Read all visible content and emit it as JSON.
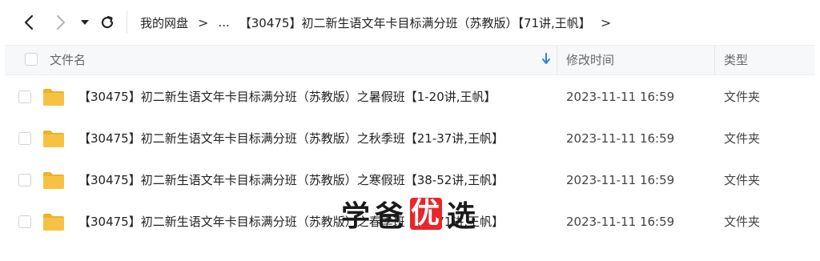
{
  "toolbar": {
    "back_icon": "chevron-left-icon",
    "forward_icon": "chevron-right-icon",
    "dropdown_icon": "caret-down-icon",
    "refresh_icon": "refresh-icon"
  },
  "breadcrumb": {
    "items": [
      "我的网盘",
      "...",
      "【30475】初二新生语文年卡目标满分班（苏教版）【71讲,王帆】"
    ],
    "separator": ">"
  },
  "table": {
    "columns": {
      "name": "文件名",
      "modified": "修改时间",
      "type": "类型"
    },
    "sort_icon": "sort-down-arrow-icon",
    "rows": [
      {
        "name": "【30475】初二新生语文年卡目标满分班（苏教版）之暑假班【1-20讲,王帆】",
        "modified": "2023-11-11 16:59",
        "type": "文件夹"
      },
      {
        "name": "【30475】初二新生语文年卡目标满分班（苏教版）之秋季班【21-37讲,王帆】",
        "modified": "2023-11-11 16:59",
        "type": "文件夹"
      },
      {
        "name": "【30475】初二新生语文年卡目标满分班（苏教版）之寒假班【38-52讲,王帆】",
        "modified": "2023-11-11 16:59",
        "type": "文件夹"
      },
      {
        "name": "【30475】初二新生语文年卡目标满分班（苏教版）之春季班【53-71讲,王帆】",
        "modified": "2023-11-11 16:59",
        "type": "文件夹"
      }
    ]
  },
  "watermark": {
    "chars": [
      "学",
      "爸",
      "优",
      "选"
    ]
  },
  "colors": {
    "folder": "#f7c244",
    "folder_dark": "#eeb22a",
    "accent_blue": "#2f80ed",
    "watermark_red": "#e8262c"
  }
}
